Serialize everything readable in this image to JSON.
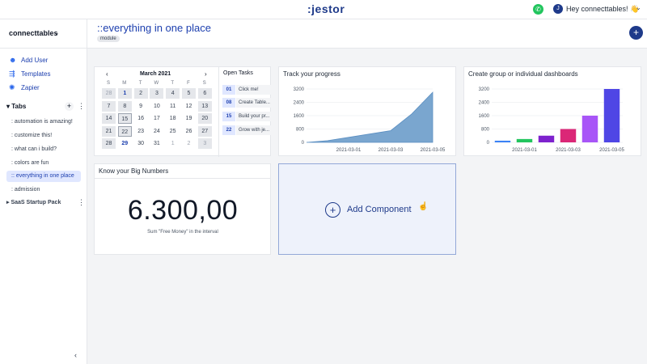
{
  "topbar": {
    "logo": ":jestor",
    "whatsapp_icon": "whatsapp-icon",
    "user_initial": "J",
    "greeting": "Hey connecttables! 👋",
    "menu_chevron": "⌄"
  },
  "sidebar": {
    "workspace": "connecttables",
    "links": [
      {
        "label": "Add User",
        "icon": "add-user-icon",
        "glyph": "👤"
      },
      {
        "label": "Templates",
        "icon": "templates-icon",
        "glyph": "⇶"
      },
      {
        "label": "Zapier",
        "icon": "zapier-icon",
        "glyph": "✺"
      }
    ],
    "tabs_header": "Tabs",
    "tabs": [
      {
        "label": ": automation is amazing!"
      },
      {
        "label": ": customize this!"
      },
      {
        "label": ": what can i build?"
      },
      {
        "label": ": colors are fun"
      },
      {
        "label": ":: everything in one place",
        "active": true
      },
      {
        "label": ": admission"
      }
    ],
    "group": "SaaS Startup Pack"
  },
  "page": {
    "title": "::everything in one place",
    "badge": "module"
  },
  "calendar": {
    "month": "March 2021",
    "prev": "‹",
    "next": "›",
    "dow": [
      "S",
      "M",
      "T",
      "W",
      "T",
      "F",
      "S"
    ],
    "weeks": [
      [
        "28",
        "1",
        "2",
        "3",
        "4",
        "5",
        "6"
      ],
      [
        "7",
        "8",
        "9",
        "10",
        "11",
        "12",
        "13"
      ],
      [
        "14",
        "15",
        "16",
        "17",
        "18",
        "19",
        "20"
      ],
      [
        "21",
        "22",
        "23",
        "24",
        "25",
        "26",
        "27"
      ],
      [
        "28",
        "29",
        "30",
        "31",
        "1",
        "2",
        "3"
      ]
    ],
    "highlighted": [
      "1",
      "29"
    ],
    "today": "22"
  },
  "open_tasks": {
    "title": "Open Tasks",
    "items": [
      {
        "num": "01",
        "text": "Click me!"
      },
      {
        "num": "08",
        "text": "Create Table..."
      },
      {
        "num": "15",
        "text": "Build your pr..."
      },
      {
        "num": "22",
        "text": "Grow with je..."
      }
    ]
  },
  "big_numbers": {
    "title": "Know your Big Numbers",
    "value": "6.300,00",
    "subtitle": "Sum \"Free Money\" in the interval"
  },
  "add_component": {
    "label": "Add Component",
    "plus": "+"
  },
  "colors": {
    "area_fill": "#7aa6cf",
    "area_stroke": "#5b8fc2",
    "bars": [
      "#3b82f6",
      "#22c55e",
      "#7e22ce",
      "#db2777",
      "#a855f7",
      "#4f46e5"
    ]
  },
  "chart_data": [
    {
      "type": "area",
      "title": "Track your progress",
      "x": [
        "2021-02-27",
        "2021-02-28",
        "2021-03-01",
        "2021-03-02",
        "2021-03-03",
        "2021-03-04",
        "2021-03-05"
      ],
      "xticks": [
        "2021-03-01",
        "2021-03-03",
        "2021-03-05"
      ],
      "values": [
        0,
        100,
        300,
        500,
        700,
        1700,
        3000
      ],
      "yticks": [
        0,
        800,
        1600,
        2400,
        3200
      ],
      "ylim": [
        0,
        3200
      ],
      "xlabel": "",
      "ylabel": "",
      "grid": true
    },
    {
      "type": "bar",
      "title": "Create group or individual dashboards",
      "categories": [
        "2021-02-28",
        "2021-03-01",
        "2021-03-02",
        "2021-03-03",
        "2021-03-04",
        "2021-03-05"
      ],
      "xticks": [
        "2021-03-01",
        "2021-03-03",
        "2021-03-05"
      ],
      "values": [
        100,
        200,
        400,
        800,
        1600,
        3200
      ],
      "yticks": [
        0,
        800,
        1600,
        2400,
        3200
      ],
      "ylim": [
        0,
        3200
      ],
      "xlabel": "",
      "ylabel": "",
      "grid": true
    }
  ]
}
